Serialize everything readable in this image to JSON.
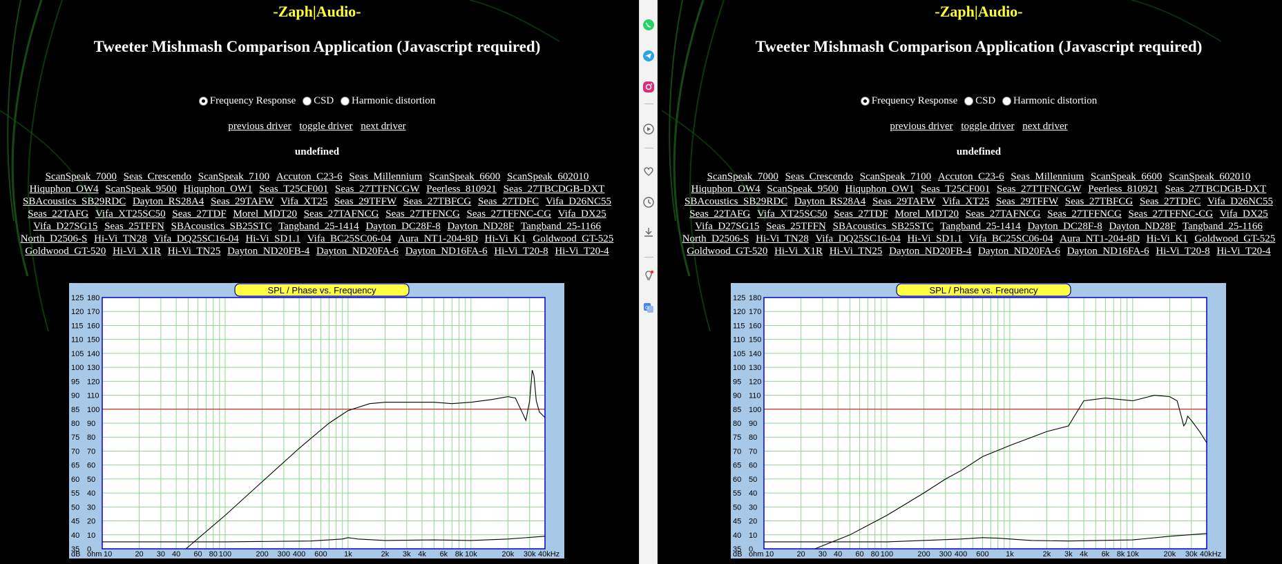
{
  "page": {
    "logo_left": "-Zaph",
    "logo_sep": "|",
    "logo_right": "Audio-",
    "title": "Tweeter Mishmash Comparison Application (Javascript required)",
    "radio_options": [
      "Frequency Response",
      "CSD",
      "Harmonic distortion"
    ],
    "radio_selected": "Frequency Response",
    "nav": {
      "previous": "previous driver",
      "toggle": "toggle driver",
      "next": "next driver"
    },
    "status": "undefined",
    "drivers": [
      "ScanSpeak_7000",
      "Seas_Crescendo",
      "ScanSpeak_7100",
      "Accuton_C23-6",
      "Seas_Millennium",
      "ScanSpeak_6600",
      "ScanSpeak_602010",
      "Hiquphon_OW4",
      "ScanSpeak_9500",
      "Hiquphon_OW1",
      "Seas_T25CF001",
      "Seas_27TTFNCGW",
      "Peerless_810921",
      "Seas_27TBCDGB-DXT",
      "SBAcoustics_SB29RDC",
      "Dayton_RS28A4",
      "Seas_29TAFW",
      "Vifa_XT25",
      "Seas_29TFFW",
      "Seas_27TBFCG",
      "Seas_27TDFC",
      "Vifa_D26NC55",
      "Seas_22TAFG",
      "Vifa_XT25SC50",
      "Seas_27TDF",
      "Morel_MDT20",
      "Seas_27TAFNCG",
      "Seas_27TFFNCG",
      "Seas_27TFFNC-CG",
      "Vifa_DX25",
      "Vifa_D27SG15",
      "Seas_25TFFN",
      "SBAcoustics_SB25STC",
      "Tangband_25-1414",
      "Dayton_DC28F-8",
      "Dayton_ND28F",
      "Tangband_25-1166",
      "North_D2506-S",
      "Hi-Vi_TN28",
      "Vifa_DQ25SC16-04",
      "Hi-Vi_SD1.1",
      "Vifa_BC25SC06-04",
      "Aura_NT1-204-8D",
      "Hi-Vi_K1",
      "Goldwood_GT-525",
      "Goldwood_GT-520",
      "Hi-Vi_X1R",
      "Hi-Vi_TN25",
      "Dayton_ND20FB-4",
      "Dayton_ND20FA-6",
      "Dayton_ND16FA-6",
      "Hi-Vi_T20-8",
      "Hi-Vi_T20-4"
    ]
  },
  "chart_common": {
    "type": "line",
    "title": "SPL / Phase vs. Frequency",
    "x_scale": "log",
    "xlim": [
      10,
      40000
    ],
    "x_ticks": [
      {
        "v": 10,
        "t": "10"
      },
      {
        "v": 20,
        "t": "20"
      },
      {
        "v": 30,
        "t": "30"
      },
      {
        "v": 40,
        "t": "40"
      },
      {
        "v": 60,
        "t": "60"
      },
      {
        "v": 80,
        "t": "80"
      },
      {
        "v": 100,
        "t": "100"
      },
      {
        "v": 200,
        "t": "200"
      },
      {
        "v": 300,
        "t": "300"
      },
      {
        "v": 400,
        "t": "400"
      },
      {
        "v": 600,
        "t": "600"
      },
      {
        "v": 1000,
        "t": "1k"
      },
      {
        "v": 2000,
        "t": "2k"
      },
      {
        "v": 3000,
        "t": "3k"
      },
      {
        "v": 4000,
        "t": "4k"
      },
      {
        "v": 6000,
        "t": "6k"
      },
      {
        "v": 8000,
        "t": "8k"
      },
      {
        "v": 10000,
        "t": "10k"
      },
      {
        "v": 20000,
        "t": "20k"
      },
      {
        "v": 30000,
        "t": "30k"
      },
      {
        "v": 40000,
        "t": "40kHz"
      }
    ],
    "db_ticks": [
      "125",
      "120",
      "115",
      "110",
      "105",
      "100",
      "95",
      "90",
      "85",
      "80",
      "75",
      "70",
      "65",
      "60",
      "55",
      "50",
      "45",
      "40",
      "35"
    ],
    "ohm_ticks": [
      "180",
      "170",
      "160",
      "150",
      "140",
      "130",
      "120",
      "110",
      "100",
      "90",
      "80",
      "70",
      "60",
      "50",
      "40",
      "30",
      "20",
      "10",
      "0"
    ],
    "db_unit": "dB",
    "ohm_unit": "ohm",
    "ylim_db": [
      35,
      125
    ],
    "ylim_ohm": [
      0,
      180
    ],
    "reference_line_db": 85,
    "grid": true,
    "colors": {
      "frame": "#a8c8e8",
      "plot_bg": "#ffffff",
      "grid": "#8fd68f",
      "plot_border": "#0000cc",
      "title_bg": "#ffff44",
      "spl_line": "#000000",
      "ref_line": "#cc0000"
    }
  },
  "chart_data": [
    {
      "type": "line",
      "series": [
        {
          "values": [
            [
              48,
              35
            ],
            [
              100,
              47
            ],
            [
              200,
              59
            ],
            [
              400,
              71
            ],
            [
              700,
              80
            ],
            [
              1000,
              84.5
            ],
            [
              1500,
              87
            ],
            [
              2000,
              87.5
            ],
            [
              3000,
              87.5
            ],
            [
              5000,
              87.5
            ],
            [
              7000,
              87
            ],
            [
              10000,
              87.5
            ],
            [
              15000,
              88.5
            ],
            [
              20000,
              89.5
            ],
            [
              23000,
              89
            ],
            [
              26000,
              84
            ],
            [
              28000,
              81
            ],
            [
              30000,
              88
            ],
            [
              31500,
              99
            ],
            [
              32500,
              97
            ],
            [
              34000,
              88
            ],
            [
              36000,
              84
            ],
            [
              40000,
              82
            ]
          ]
        },
        {
          "values": [
            [
              10,
              37.5
            ],
            [
              100,
              37.5
            ],
            [
              500,
              37.8
            ],
            [
              900,
              38.5
            ],
            [
              1000,
              39
            ],
            [
              1200,
              38.5
            ],
            [
              2000,
              38
            ],
            [
              5000,
              38.2
            ],
            [
              10000,
              38
            ],
            [
              20000,
              38.5
            ],
            [
              40000,
              39.5
            ]
          ]
        }
      ]
    },
    {
      "type": "line",
      "series": [
        {
          "values": [
            [
              26,
              35
            ],
            [
              50,
              40
            ],
            [
              100,
              47
            ],
            [
              200,
              55
            ],
            [
              300,
              60
            ],
            [
              400,
              63
            ],
            [
              600,
              68
            ],
            [
              1000,
              72
            ],
            [
              2000,
              77
            ],
            [
              3000,
              79
            ],
            [
              4000,
              88
            ],
            [
              6000,
              89
            ],
            [
              10000,
              88
            ],
            [
              15000,
              90
            ],
            [
              20000,
              89.5
            ],
            [
              23000,
              88
            ],
            [
              25000,
              82
            ],
            [
              26000,
              79
            ],
            [
              27000,
              80
            ],
            [
              28000,
              82.5
            ],
            [
              30000,
              81
            ],
            [
              35000,
              77
            ],
            [
              40000,
              73
            ]
          ]
        },
        {
          "values": [
            [
              10,
              37.5
            ],
            [
              100,
              37.5
            ],
            [
              400,
              38.5
            ],
            [
              600,
              39
            ],
            [
              800,
              38.8
            ],
            [
              1500,
              38
            ],
            [
              3000,
              37.8
            ],
            [
              10000,
              38.2
            ],
            [
              20000,
              39.5
            ],
            [
              40000,
              40.5
            ]
          ]
        }
      ]
    }
  ]
}
